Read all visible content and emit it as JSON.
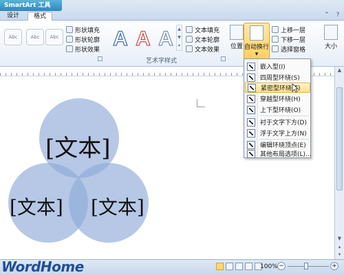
{
  "ribbon_tabs": {
    "context_title": "SmartArt 工具",
    "design": "设计",
    "format": "格式"
  },
  "shape_styles": {
    "thumb_label": "Abc",
    "fill": "形状填充",
    "outline": "形状轮廓",
    "effects": "形状效果"
  },
  "wordart": {
    "sample": "A",
    "text_fill": "文本填充",
    "text_outline": "文本轮廓",
    "text_effects": "文本效果",
    "group_label": "艺术字样式"
  },
  "arrange": {
    "position": "位置",
    "auto_wrap": "自动换行",
    "bring_forward": "上移一层",
    "send_backward": "下移一层",
    "selection_pane": "选择窗格",
    "size": "大小"
  },
  "wrap_menu": {
    "items": [
      {
        "label": "嵌入型(I)"
      },
      {
        "label": "四周型环绕(S)"
      },
      {
        "label": "紧密型环绕(T)"
      },
      {
        "label": "穿越型环绕(H)"
      },
      {
        "label": "上下型环绕(O)"
      },
      {
        "label": "衬于文字下方(D)"
      },
      {
        "label": "浮于文字上方(N)"
      },
      {
        "label": "编辑环绕顶点(E)"
      },
      {
        "label": "其他布局选项(L)..."
      }
    ],
    "hover_index": 2
  },
  "document": {
    "venn_top": "[文本]",
    "venn_left": "[文本]",
    "venn_right": "[文本]",
    "venn_color": "#8faad8"
  },
  "status": {
    "logo": "WordHome",
    "zoom": "100%"
  }
}
